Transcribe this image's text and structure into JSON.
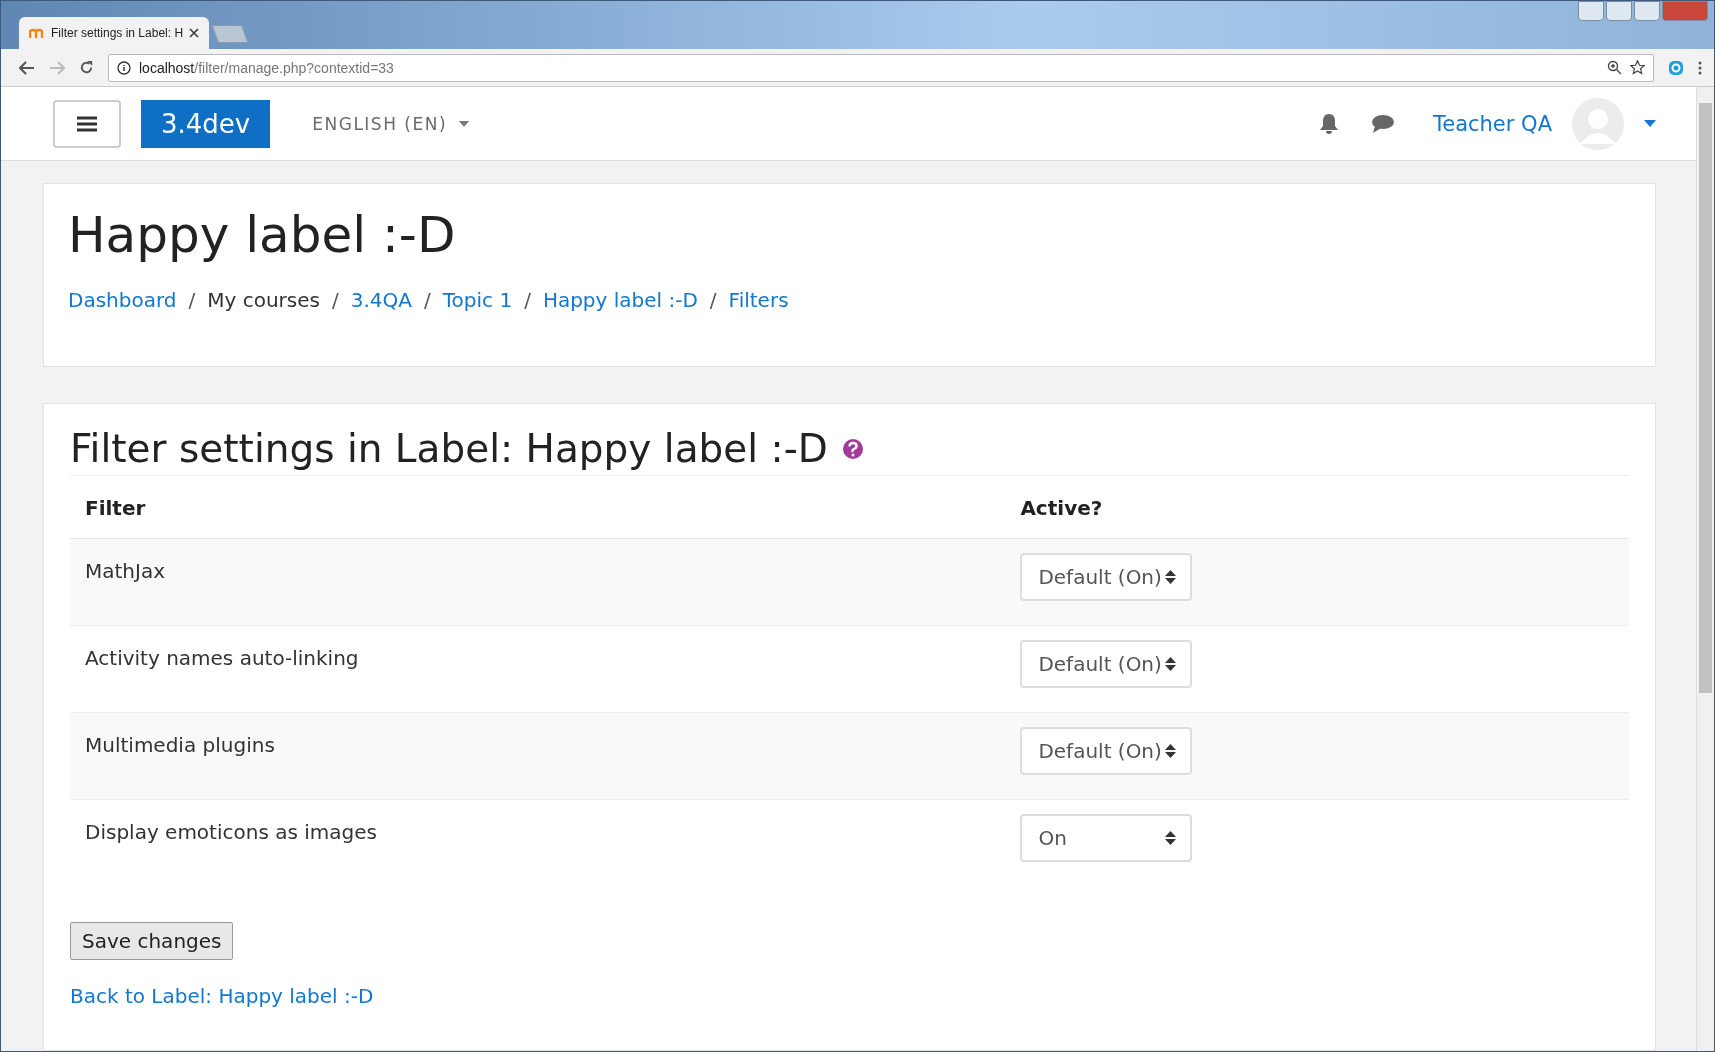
{
  "browser": {
    "tab_title": "Filter settings in Label: H",
    "address": {
      "host": "localhost",
      "path": "/filter/manage.php?contextid=33"
    }
  },
  "navbar": {
    "brand": "3.4dev",
    "language": "ENGLISH (EN)",
    "user_name": "Teacher QA"
  },
  "header": {
    "title": "Happy label :-D",
    "breadcrumb_separator": "/",
    "breadcrumb": [
      {
        "label": "Dashboard",
        "kind": "link"
      },
      {
        "label": "My courses",
        "kind": "text"
      },
      {
        "label": "3.4QA",
        "kind": "link"
      },
      {
        "label": "Topic 1",
        "kind": "link"
      },
      {
        "label": "Happy label :-D",
        "kind": "link"
      },
      {
        "label": "Filters",
        "kind": "link"
      }
    ]
  },
  "main": {
    "title": "Filter settings in Label: Happy label :-D",
    "table": {
      "columns": [
        "Filter",
        "Active?"
      ],
      "rows": [
        {
          "filter": "MathJax",
          "active": "Default (On)"
        },
        {
          "filter": "Activity names auto-linking",
          "active": "Default (On)"
        },
        {
          "filter": "Multimedia plugins",
          "active": "Default (On)"
        },
        {
          "filter": "Display emoticons as images",
          "active": "On"
        }
      ]
    },
    "save_button": "Save changes",
    "back_link": "Back to Label: Happy label :-D"
  }
}
